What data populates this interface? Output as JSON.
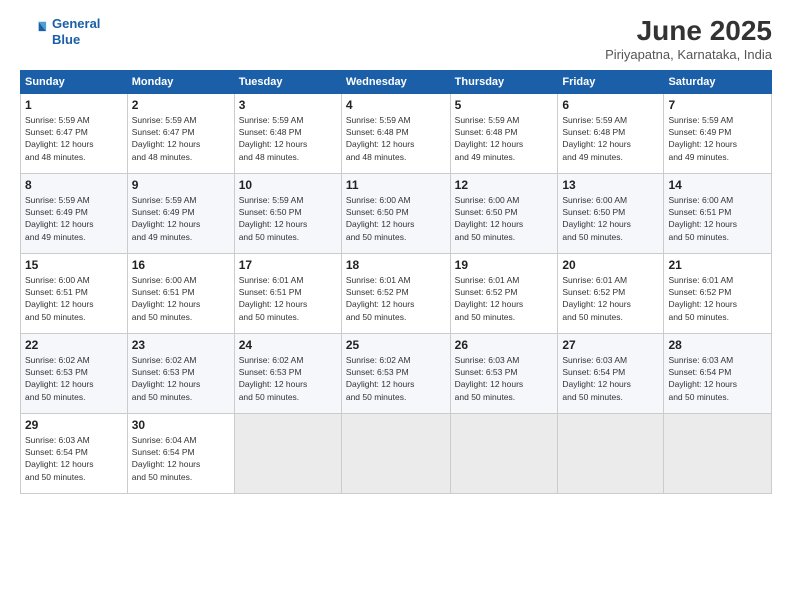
{
  "logo": {
    "line1": "General",
    "line2": "Blue"
  },
  "title": "June 2025",
  "location": "Piriyapatna, Karnataka, India",
  "weekdays": [
    "Sunday",
    "Monday",
    "Tuesday",
    "Wednesday",
    "Thursday",
    "Friday",
    "Saturday"
  ],
  "weeks": [
    [
      {
        "day": "1",
        "info": "Sunrise: 5:59 AM\nSunset: 6:47 PM\nDaylight: 12 hours\nand 48 minutes."
      },
      {
        "day": "2",
        "info": "Sunrise: 5:59 AM\nSunset: 6:47 PM\nDaylight: 12 hours\nand 48 minutes."
      },
      {
        "day": "3",
        "info": "Sunrise: 5:59 AM\nSunset: 6:48 PM\nDaylight: 12 hours\nand 48 minutes."
      },
      {
        "day": "4",
        "info": "Sunrise: 5:59 AM\nSunset: 6:48 PM\nDaylight: 12 hours\nand 48 minutes."
      },
      {
        "day": "5",
        "info": "Sunrise: 5:59 AM\nSunset: 6:48 PM\nDaylight: 12 hours\nand 49 minutes."
      },
      {
        "day": "6",
        "info": "Sunrise: 5:59 AM\nSunset: 6:48 PM\nDaylight: 12 hours\nand 49 minutes."
      },
      {
        "day": "7",
        "info": "Sunrise: 5:59 AM\nSunset: 6:49 PM\nDaylight: 12 hours\nand 49 minutes."
      }
    ],
    [
      {
        "day": "8",
        "info": "Sunrise: 5:59 AM\nSunset: 6:49 PM\nDaylight: 12 hours\nand 49 minutes."
      },
      {
        "day": "9",
        "info": "Sunrise: 5:59 AM\nSunset: 6:49 PM\nDaylight: 12 hours\nand 49 minutes."
      },
      {
        "day": "10",
        "info": "Sunrise: 5:59 AM\nSunset: 6:50 PM\nDaylight: 12 hours\nand 50 minutes."
      },
      {
        "day": "11",
        "info": "Sunrise: 6:00 AM\nSunset: 6:50 PM\nDaylight: 12 hours\nand 50 minutes."
      },
      {
        "day": "12",
        "info": "Sunrise: 6:00 AM\nSunset: 6:50 PM\nDaylight: 12 hours\nand 50 minutes."
      },
      {
        "day": "13",
        "info": "Sunrise: 6:00 AM\nSunset: 6:50 PM\nDaylight: 12 hours\nand 50 minutes."
      },
      {
        "day": "14",
        "info": "Sunrise: 6:00 AM\nSunset: 6:51 PM\nDaylight: 12 hours\nand 50 minutes."
      }
    ],
    [
      {
        "day": "15",
        "info": "Sunrise: 6:00 AM\nSunset: 6:51 PM\nDaylight: 12 hours\nand 50 minutes."
      },
      {
        "day": "16",
        "info": "Sunrise: 6:00 AM\nSunset: 6:51 PM\nDaylight: 12 hours\nand 50 minutes."
      },
      {
        "day": "17",
        "info": "Sunrise: 6:01 AM\nSunset: 6:51 PM\nDaylight: 12 hours\nand 50 minutes."
      },
      {
        "day": "18",
        "info": "Sunrise: 6:01 AM\nSunset: 6:52 PM\nDaylight: 12 hours\nand 50 minutes."
      },
      {
        "day": "19",
        "info": "Sunrise: 6:01 AM\nSunset: 6:52 PM\nDaylight: 12 hours\nand 50 minutes."
      },
      {
        "day": "20",
        "info": "Sunrise: 6:01 AM\nSunset: 6:52 PM\nDaylight: 12 hours\nand 50 minutes."
      },
      {
        "day": "21",
        "info": "Sunrise: 6:01 AM\nSunset: 6:52 PM\nDaylight: 12 hours\nand 50 minutes."
      }
    ],
    [
      {
        "day": "22",
        "info": "Sunrise: 6:02 AM\nSunset: 6:53 PM\nDaylight: 12 hours\nand 50 minutes."
      },
      {
        "day": "23",
        "info": "Sunrise: 6:02 AM\nSunset: 6:53 PM\nDaylight: 12 hours\nand 50 minutes."
      },
      {
        "day": "24",
        "info": "Sunrise: 6:02 AM\nSunset: 6:53 PM\nDaylight: 12 hours\nand 50 minutes."
      },
      {
        "day": "25",
        "info": "Sunrise: 6:02 AM\nSunset: 6:53 PM\nDaylight: 12 hours\nand 50 minutes."
      },
      {
        "day": "26",
        "info": "Sunrise: 6:03 AM\nSunset: 6:53 PM\nDaylight: 12 hours\nand 50 minutes."
      },
      {
        "day": "27",
        "info": "Sunrise: 6:03 AM\nSunset: 6:54 PM\nDaylight: 12 hours\nand 50 minutes."
      },
      {
        "day": "28",
        "info": "Sunrise: 6:03 AM\nSunset: 6:54 PM\nDaylight: 12 hours\nand 50 minutes."
      }
    ],
    [
      {
        "day": "29",
        "info": "Sunrise: 6:03 AM\nSunset: 6:54 PM\nDaylight: 12 hours\nand 50 minutes."
      },
      {
        "day": "30",
        "info": "Sunrise: 6:04 AM\nSunset: 6:54 PM\nDaylight: 12 hours\nand 50 minutes."
      },
      null,
      null,
      null,
      null,
      null
    ]
  ]
}
